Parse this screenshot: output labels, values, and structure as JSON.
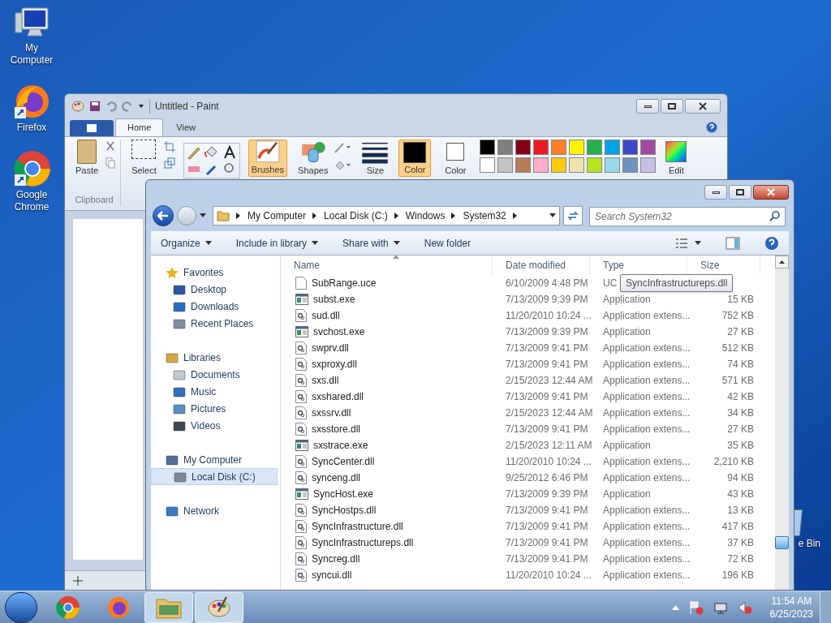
{
  "desktop_icons": [
    {
      "label": "My Computer",
      "kind": "computer"
    },
    {
      "label": "Firefox",
      "kind": "firefox"
    },
    {
      "label": "Google Chrome",
      "kind": "chrome"
    }
  ],
  "recycle_bin": {
    "label": "e Bin"
  },
  "paint": {
    "title": "Untitled - Paint",
    "tabs": [
      {
        "label": "Home",
        "selected": true
      },
      {
        "label": "View",
        "selected": false
      }
    ],
    "tools": [
      {
        "label": "Paste",
        "kind": "paste"
      },
      {
        "label": "Select",
        "kind": "select"
      },
      {
        "label": "Brushes",
        "kind": "brushes"
      },
      {
        "label": "Shapes",
        "kind": "shapes"
      },
      {
        "label": "Size",
        "kind": "size"
      }
    ],
    "clipboard_label": "Clipboard",
    "color_slots": [
      {
        "label": "Color",
        "color": "#000000",
        "selected": true
      },
      {
        "label": "Color",
        "color": "#ffffff",
        "selected": false
      }
    ],
    "palette": [
      {
        "color": "#000000"
      },
      {
        "color": "#7f7f7f"
      },
      {
        "color": "#880015"
      },
      {
        "color": "#ed1c24"
      },
      {
        "color": "#ff7f27"
      },
      {
        "color": "#fff200"
      },
      {
        "color": "#22b14c"
      },
      {
        "color": "#00a2e8"
      },
      {
        "color": "#3f48cc"
      },
      {
        "color": "#a349a4"
      },
      {
        "color": "#ffffff"
      },
      {
        "color": "#c3c3c3"
      },
      {
        "color": "#b97a57"
      },
      {
        "color": "#ffaec9"
      },
      {
        "color": "#ffc90e"
      },
      {
        "color": "#efe4b0"
      },
      {
        "color": "#b5e61d"
      },
      {
        "color": "#99d9ea"
      },
      {
        "color": "#7092be"
      },
      {
        "color": "#c8bfe7"
      }
    ],
    "edit_label": "Edit"
  },
  "explorer": {
    "breadcrumb": [
      "My Computer",
      "Local Disk (C:)",
      "Windows",
      "System32"
    ],
    "search": {
      "placeholder": "Search System32"
    },
    "toolbar": [
      {
        "label": "Organize",
        "dropdown": true
      },
      {
        "label": "Include in library",
        "dropdown": true
      },
      {
        "label": "Share with",
        "dropdown": true
      },
      {
        "label": "New folder",
        "dropdown": false
      }
    ],
    "nav": [
      {
        "label": "Favorites",
        "kind": "star",
        "selected": false,
        "children": [
          {
            "label": "Desktop",
            "kind": "desktop",
            "selected": false
          },
          {
            "label": "Downloads",
            "kind": "downloads",
            "selected": false
          },
          {
            "label": "Recent Places",
            "kind": "recent",
            "selected": false
          }
        ]
      },
      {
        "label": "Libraries",
        "kind": "library",
        "selected": false,
        "children": [
          {
            "label": "Documents",
            "kind": "documents",
            "selected": false
          },
          {
            "label": "Music",
            "kind": "music",
            "selected": false
          },
          {
            "label": "Pictures",
            "kind": "pictures",
            "selected": false
          },
          {
            "label": "Videos",
            "kind": "videos",
            "selected": false
          }
        ]
      },
      {
        "label": "My Computer",
        "kind": "computer",
        "selected": false,
        "children": [
          {
            "label": "Local Disk (C:)",
            "kind": "disk",
            "selected": true
          }
        ]
      },
      {
        "label": "Network",
        "kind": "network",
        "selected": false
      }
    ],
    "columns": [
      "Name",
      "Date modified",
      "Type",
      "Size"
    ],
    "rows": [
      {
        "name": "SubRange.uce",
        "date": "6/10/2009 4:48 PM",
        "type": "UC",
        "kind": "file"
      },
      {
        "name": "subst.exe",
        "date": "7/13/2009 9:39 PM",
        "type": "Application",
        "size": "15 KB",
        "kind": "exe"
      },
      {
        "name": "sud.dll",
        "date": "11/20/2010 10:24 ...",
        "type": "Application extens...",
        "size": "752 KB",
        "kind": "dll"
      },
      {
        "name": "svchost.exe",
        "date": "7/13/2009 9:39 PM",
        "type": "Application",
        "size": "27 KB",
        "kind": "exe"
      },
      {
        "name": "swprv.dll",
        "date": "7/13/2009 9:41 PM",
        "type": "Application extens...",
        "size": "512 KB",
        "kind": "dll"
      },
      {
        "name": "sxproxy.dll",
        "date": "7/13/2009 9:41 PM",
        "type": "Application extens...",
        "size": "74 KB",
        "kind": "dll"
      },
      {
        "name": "sxs.dll",
        "date": "2/15/2023 12:44 AM",
        "type": "Application extens...",
        "size": "571 KB",
        "kind": "dll"
      },
      {
        "name": "sxshared.dll",
        "date": "7/13/2009 9:41 PM",
        "type": "Application extens...",
        "size": "42 KB",
        "kind": "dll"
      },
      {
        "name": "sxssrv.dll",
        "date": "2/15/2023 12:44 AM",
        "type": "Application extens...",
        "size": "34 KB",
        "kind": "dll"
      },
      {
        "name": "sxsstore.dll",
        "date": "7/13/2009 9:41 PM",
        "type": "Application extens...",
        "size": "27 KB",
        "kind": "dll"
      },
      {
        "name": "sxstrace.exe",
        "date": "2/15/2023 12:11 AM",
        "type": "Application",
        "size": "35 KB",
        "kind": "exe"
      },
      {
        "name": "SyncCenter.dll",
        "date": "11/20/2010 10:24 ...",
        "type": "Application extens...",
        "size": "2,210 KB",
        "kind": "dll"
      },
      {
        "name": "synceng.dll",
        "date": "9/25/2012 6:46 PM",
        "type": "Application extens...",
        "size": "94 KB",
        "kind": "dll"
      },
      {
        "name": "SyncHost.exe",
        "date": "7/13/2009 9:39 PM",
        "type": "Application",
        "size": "43 KB",
        "kind": "exe"
      },
      {
        "name": "SyncHostps.dll",
        "date": "7/13/2009 9:41 PM",
        "type": "Application extens...",
        "size": "13 KB",
        "kind": "dll"
      },
      {
        "name": "SyncInfrastructure.dll",
        "date": "7/13/2009 9:41 PM",
        "type": "Application extens...",
        "size": "417 KB",
        "kind": "dll"
      },
      {
        "name": "SyncInfrastructureps.dll",
        "date": "7/13/2009 9:41 PM",
        "type": "Application extens...",
        "size": "37 KB",
        "kind": "dll"
      },
      {
        "name": "Syncreg.dll",
        "date": "7/13/2009 9:41 PM",
        "type": "Application extens...",
        "size": "72 KB",
        "kind": "dll"
      },
      {
        "name": "syncui.dll",
        "date": "11/20/2010 10:24 ...",
        "type": "Application extens...",
        "size": "196 KB",
        "kind": "dll"
      }
    ],
    "tooltip": "SyncInfrastructureps.dll"
  },
  "taskbar": {
    "apps": [
      {
        "kind": "chrome",
        "active": false
      },
      {
        "kind": "firefox",
        "active": false
      },
      {
        "kind": "explorer",
        "active": true
      },
      {
        "kind": "paint",
        "active": true
      }
    ],
    "time": "11:54 AM",
    "date": "6/25/2023"
  }
}
